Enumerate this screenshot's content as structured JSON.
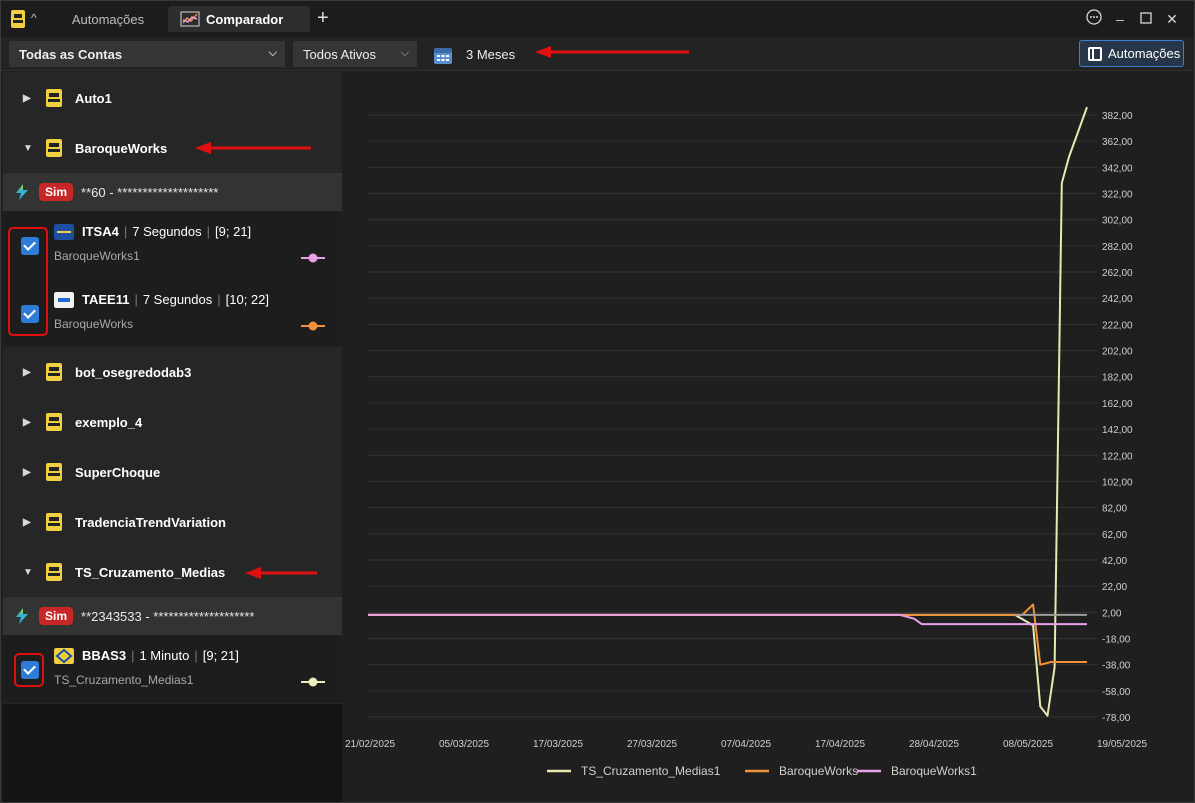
{
  "titlebar": {
    "tabs": [
      {
        "label": "Automações",
        "active": false
      },
      {
        "label": "Comparador",
        "active": true
      }
    ]
  },
  "toolbar": {
    "accounts_value": "Todas as Contas",
    "assets_value": "Todos Ativos",
    "period_label": "3 Meses",
    "automacoes_button": "Automações"
  },
  "sidebar": {
    "groups": [
      {
        "name": "Auto1",
        "expanded": false
      },
      {
        "name": "BaroqueWorks",
        "expanded": true
      },
      {
        "name": "bot_osegredodab3",
        "expanded": false
      },
      {
        "name": "exemplo_4",
        "expanded": false
      },
      {
        "name": "SuperChoque",
        "expanded": false
      },
      {
        "name": "TradenciaTrendVariation",
        "expanded": false
      },
      {
        "name": "TS_Cruzamento_Medias",
        "expanded": true
      }
    ],
    "accounts": [
      {
        "badge": "Sim",
        "label": "**60 - ********************"
      },
      {
        "badge": "Sim",
        "label": "**2343533 - ********************"
      }
    ],
    "strategies": [
      {
        "ticker": "ITSA4",
        "timeframe": "7 Segundos",
        "params": "[9; 21]",
        "owner": "BaroqueWorks1",
        "color": "#e8a0e8",
        "checked": true
      },
      {
        "ticker": "TAEE11",
        "timeframe": "7 Segundos",
        "params": "[10; 22]",
        "owner": "BaroqueWorks",
        "color": "#f0913c",
        "checked": true
      },
      {
        "ticker": "BBAS3",
        "timeframe": "1 Minuto",
        "params": "[9; 21]",
        "owner": "TS_Cruzamento_Medias1",
        "color": "#eeeebb",
        "checked": true
      }
    ]
  },
  "chart_data": {
    "type": "line",
    "y_ticks": [
      "382,00",
      "362,00",
      "342,00",
      "322,00",
      "302,00",
      "282,00",
      "262,00",
      "242,00",
      "222,00",
      "202,00",
      "182,00",
      "162,00",
      "142,00",
      "122,00",
      "102,00",
      "82,00",
      "62,00",
      "42,00",
      "22,00",
      "2,00",
      "-18,00",
      "-38,00",
      "-58,00",
      "-78,00"
    ],
    "x_ticks": [
      "21/02/2025",
      "05/03/2025",
      "17/03/2025",
      "27/03/2025",
      "07/04/2025",
      "17/04/2025",
      "28/04/2025",
      "08/05/2025",
      "19/05/2025"
    ],
    "ylim": [
      -78,
      382
    ],
    "grid": true,
    "legend_placement": "bottom",
    "series": [
      {
        "name": "TS_Cruzamento_Medias1",
        "color": "#e8e8b0",
        "points": [
          [
            0,
            0
          ],
          [
            0.77,
            0
          ],
          [
            0.9,
            0
          ],
          [
            0.925,
            -8
          ],
          [
            0.935,
            -70
          ],
          [
            0.945,
            -77
          ],
          [
            0.955,
            -40
          ],
          [
            0.965,
            330
          ],
          [
            0.975,
            350
          ],
          [
            1.0,
            388
          ]
        ]
      },
      {
        "name": "BaroqueWorks",
        "color": "#f0913c",
        "points": [
          [
            0,
            0
          ],
          [
            0.75,
            0
          ],
          [
            0.88,
            0
          ],
          [
            0.91,
            0
          ],
          [
            0.925,
            8
          ],
          [
            0.935,
            -38
          ],
          [
            0.95,
            -36
          ],
          [
            1.0,
            -36
          ]
        ]
      },
      {
        "name": "BaroqueWorks1",
        "color": "#e8a0e8",
        "points": [
          [
            0,
            0
          ],
          [
            0.74,
            0
          ],
          [
            0.76,
            -3
          ],
          [
            0.77,
            -7
          ],
          [
            0.8,
            -7
          ],
          [
            1.0,
            -7
          ]
        ]
      },
      {
        "name": "",
        "color": "#9e9e9e",
        "points": [
          [
            0.9,
            0
          ],
          [
            1.0,
            0
          ]
        ]
      }
    ],
    "legend": [
      "TS_Cruzamento_Medias1",
      "BaroqueWorks",
      "BaroqueWorks1"
    ]
  }
}
